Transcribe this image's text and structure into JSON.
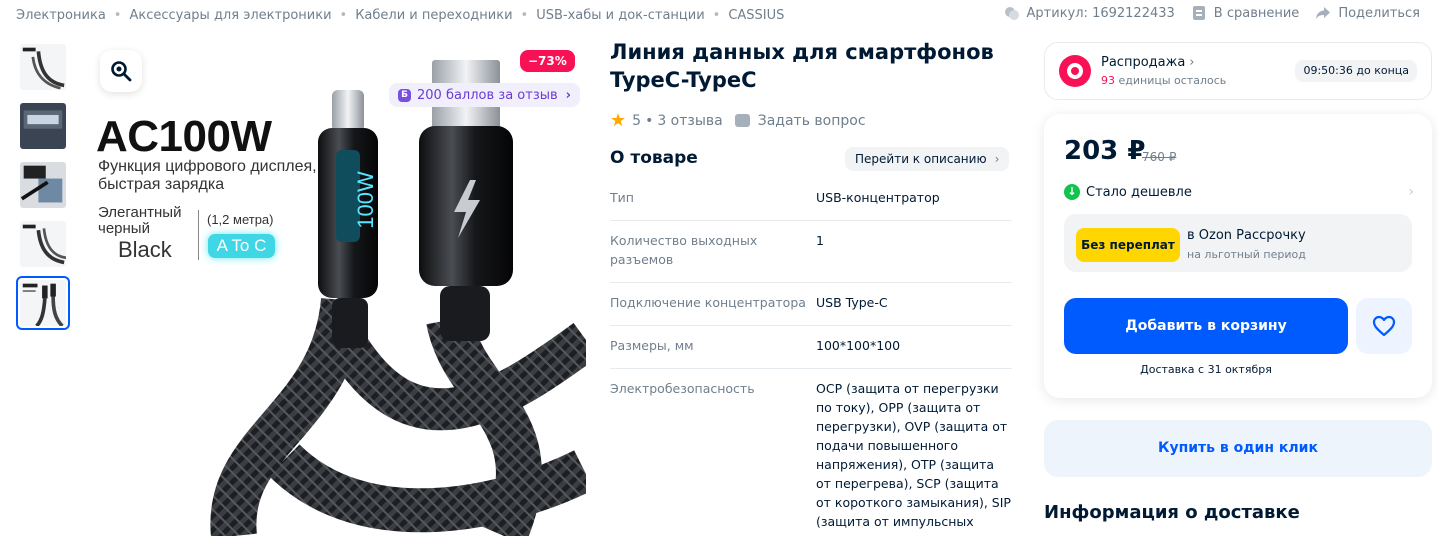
{
  "breadcrumbs": [
    "Электроника",
    "Аксессуары для электроники",
    "Кабели и переходники",
    "USB-хабы и док-станции",
    "CASSIUS"
  ],
  "top_actions": {
    "article": "Артикул: 1692122433",
    "compare": "В сравнение",
    "share": "Поделиться"
  },
  "gallery": {
    "thumbnails": [
      "thumb-1",
      "thumb-2",
      "thumb-3",
      "thumb-4",
      "thumb-5"
    ],
    "active_index": 4,
    "discount_badge": "−73%",
    "bonus_label": "200 баллов за отзыв",
    "bonus_icon_letter": "Б",
    "image_text": {
      "title": "AC100W",
      "subtitle": "Функция цифрового дисплея, быстрая зарядка",
      "elegant": "Элегантный черный",
      "black": "Black",
      "length": "(1,2 метра)",
      "atoc": "A To C"
    }
  },
  "product": {
    "title": "Линия данных для смартфонов TypeC-TypeC",
    "rating": "5",
    "reviews": "3 отзыва",
    "ask_question": "Задать вопрос",
    "about_title": "О товаре",
    "to_description": "Перейти к описанию",
    "specs": [
      {
        "key": "Тип",
        "value": "USB-концентратор"
      },
      {
        "key": "Количество выходных разъемов",
        "value": "1"
      },
      {
        "key": "Подключение концентратора",
        "value": "USB Type-C"
      },
      {
        "key": "Размеры, мм",
        "value": "100*100*100"
      },
      {
        "key": "Электробезопасность",
        "value": "OCP (защита от перегрузки по току), OPP (защита от перегрузки), OVP (защита от подачи повышенного напряжения), OTP (защита от перегрева), SCP (защита от короткого замыкания), SIP (защита от импульсных"
      }
    ]
  },
  "sale": {
    "title": "Распродажа",
    "remaining_count": "93",
    "remaining_text": " единицы осталось",
    "timer": "09:50:36 до конца"
  },
  "buy": {
    "price": "203 ₽",
    "old_price": "760 ₽",
    "cheaper": "Стало дешевле",
    "install_badge": "Без переплат",
    "install_line1": "в Ozon Рассрочку",
    "install_line2": "на льготный период",
    "add_to_cart": "Добавить в корзину",
    "delivery": "Доставка с 31 октября",
    "one_click": "Купить в один клик"
  },
  "delivery_info_title": "Информация о доставке",
  "colors": {
    "accent": "#005bff",
    "sale": "#f91155",
    "bonus": "#6b3bd4",
    "installment": "#ffd600",
    "cheaper": "#10c44c"
  }
}
